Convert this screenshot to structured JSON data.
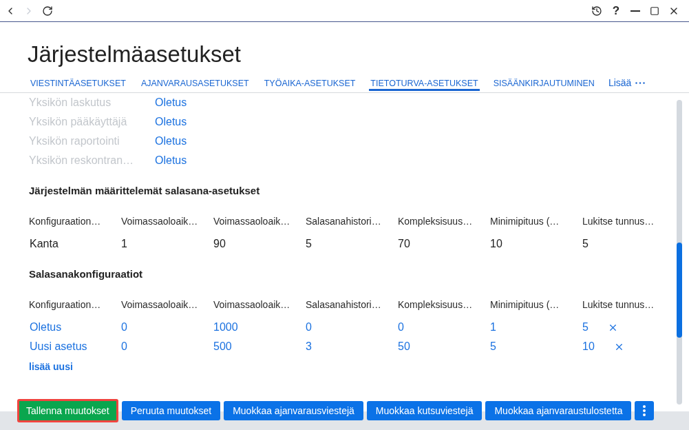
{
  "toolbar": {
    "nav": [
      {
        "kind": "back",
        "disabled": false
      },
      {
        "kind": "forward",
        "disabled": true
      },
      {
        "kind": "refresh",
        "disabled": false
      }
    ],
    "controls": [
      {
        "kind": "history"
      },
      {
        "kind": "help",
        "text": "?"
      },
      {
        "kind": "minimize"
      },
      {
        "kind": "maximize"
      },
      {
        "kind": "close"
      }
    ]
  },
  "page_title": "Järjestelmäasetukset",
  "tabs": [
    {
      "label": "VIESTINTÄASETUKSET",
      "selected": false
    },
    {
      "label": "AJANVARAUSASETUKSET",
      "selected": false
    },
    {
      "label": "TYÖAIKA-ASETUKSET",
      "selected": false
    },
    {
      "label": "TIETOTURVA-ASETUKSET",
      "selected": true
    },
    {
      "label": "SISÄÄNKIRJAUTUMINEN",
      "selected": false
    }
  ],
  "more_tab": {
    "label": "Lisää"
  },
  "unit_settings": [
    {
      "label": "Yksikön laskutus",
      "value": "Oletus",
      "disabled": true
    },
    {
      "label": "Yksikön pääkäyttäjä",
      "value": "Oletus",
      "disabled": true
    },
    {
      "label": "Yksikön raportointi",
      "value": "Oletus",
      "disabled": true
    },
    {
      "label": "Yksikön reskontran…",
      "value": "Oletus",
      "disabled": true
    }
  ],
  "sections": [
    {
      "heading": "Järjestelmän määrittelemät salasana-asetukset",
      "clickable": false,
      "columns": [
        "Konfiguraation…",
        "Voimassaoloaik…",
        "Voimassaoloaik…",
        "Salasanahistori…",
        "Kompleksisuus…",
        "Minimipituus (…",
        "Lukitse tunnus…"
      ],
      "rows": [
        {
          "cells": [
            "Kanta",
            "1",
            "90",
            "5",
            "70",
            "10",
            "5"
          ]
        }
      ]
    },
    {
      "heading": "Salasanakonfiguraatiot",
      "clickable": true,
      "columns": [
        "Konfiguraation…",
        "Voimassaoloaik…",
        "Voimassaoloaik…",
        "Salasanahistori…",
        "Kompleksisuus…",
        "Minimipituus (…",
        "Lukitse tunnus…"
      ],
      "rows": [
        {
          "cells": [
            "Oletus",
            "0",
            "1000",
            "0",
            "0",
            "1",
            "5"
          ],
          "deletable": true
        },
        {
          "cells": [
            "Uusi asetus",
            "0",
            "500",
            "3",
            "50",
            "5",
            "10"
          ],
          "deletable": true
        }
      ],
      "add_link": "lisää uusi"
    }
  ],
  "actions": [
    {
      "label": "Tallenna muutokset",
      "kind": "primary",
      "focused": true
    },
    {
      "label": "Peruuta muutokset",
      "kind": "secondary",
      "focused": false
    },
    {
      "label": "Muokkaa ajanvarausviestejä",
      "kind": "secondary",
      "focused": false
    },
    {
      "label": "Muokkaa kutsuviestejä",
      "kind": "secondary",
      "focused": false
    },
    {
      "label": "Muokkaa ajanvaraustulostetta",
      "kind": "secondary",
      "focused": false
    }
  ]
}
